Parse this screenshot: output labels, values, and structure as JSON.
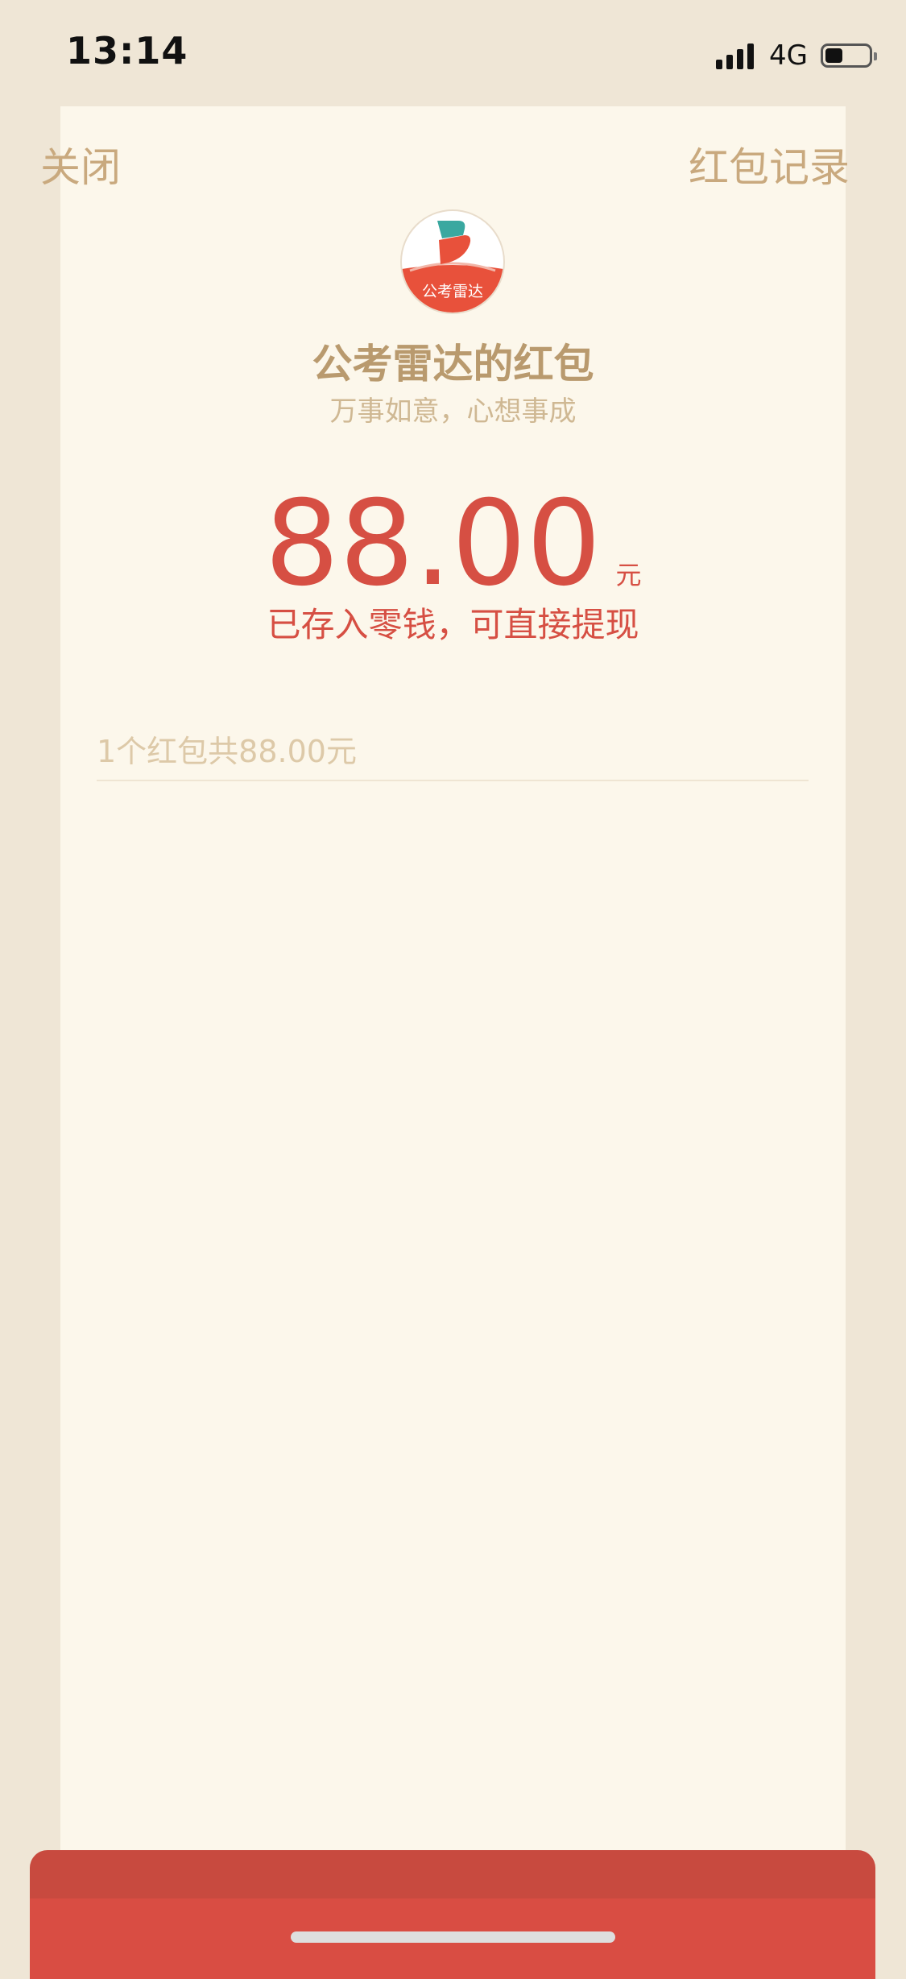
{
  "status_bar": {
    "time": "13:14",
    "network": "4G",
    "battery_level_percent": 40
  },
  "nav": {
    "close_label": "关闭",
    "records_label": "红包记录"
  },
  "logo": {
    "text": "公考雷达",
    "colors": {
      "teal": "#3aa8a0",
      "red": "#e8513b",
      "white": "#ffffff"
    }
  },
  "sender": {
    "title": "公考雷达的红包",
    "wish": "万事如意，心想事成"
  },
  "amount": {
    "value": "88.00",
    "currency": "元",
    "note": "已存入零钱，可直接提现"
  },
  "summary": {
    "text": "1个红包共88.00元"
  },
  "colors": {
    "background": "#efe6d6",
    "card": "#fcf7eb",
    "accent_red": "#d64f43",
    "gold_text": "#b99a6e",
    "envelope_red": "#d94d43"
  }
}
